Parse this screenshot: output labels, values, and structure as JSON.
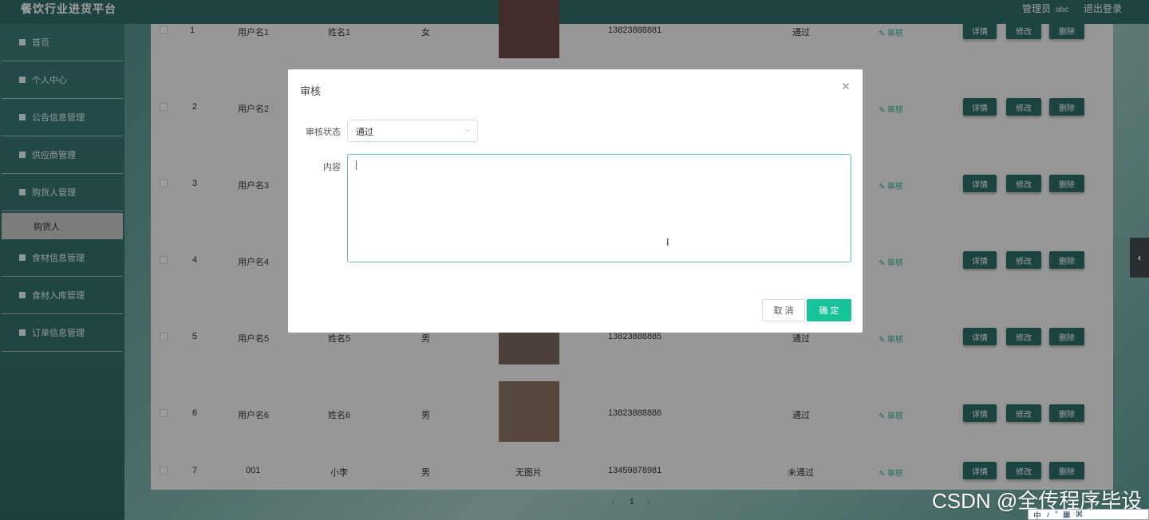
{
  "header": {
    "title": "餐饮行业进货平台",
    "user_label": "管理员",
    "user_name": "abc",
    "logout": "退出登录"
  },
  "sidebar": {
    "items": [
      {
        "label": "首页",
        "icon": "home-icon"
      },
      {
        "label": "个人中心",
        "icon": "user-icon"
      },
      {
        "label": "公告信息管理",
        "icon": "grid-icon"
      },
      {
        "label": "供应商管理",
        "icon": "grid-icon"
      },
      {
        "label": "购货人管理",
        "icon": "menu-icon"
      },
      {
        "label": "购货人",
        "icon": ""
      },
      {
        "label": "食材信息管理",
        "icon": "flag-icon"
      },
      {
        "label": "食材入库管理",
        "icon": "square-icon"
      },
      {
        "label": "订单信息管理",
        "icon": "list-icon"
      }
    ]
  },
  "table": {
    "rows": [
      {
        "idx": "1",
        "username": "用户名1",
        "name": "姓名1",
        "gender": "女",
        "photo": "",
        "phone": "13823888881",
        "status": "通过"
      },
      {
        "idx": "2",
        "username": "用户名2",
        "name": "",
        "gender": "",
        "photo": "",
        "phone": "",
        "status": ""
      },
      {
        "idx": "3",
        "username": "用户名3",
        "name": "",
        "gender": "",
        "photo": "",
        "phone": "",
        "status": ""
      },
      {
        "idx": "4",
        "username": "用户名4",
        "name": "",
        "gender": "",
        "photo": "",
        "phone": "",
        "status": ""
      },
      {
        "idx": "5",
        "username": "用户名5",
        "name": "姓名5",
        "gender": "男",
        "photo": "",
        "phone": "13823888885",
        "status": "通过"
      },
      {
        "idx": "6",
        "username": "用户名6",
        "name": "姓名6",
        "gender": "男",
        "photo": "",
        "phone": "13823888886",
        "status": "通过"
      },
      {
        "idx": "7",
        "username": "001",
        "name": "小李",
        "gender": "男",
        "photo": "无图片",
        "phone": "13459878981",
        "status": "未通过"
      }
    ],
    "audit_label": "审核",
    "detail_label": "详情",
    "edit_label": "修改",
    "delete_label": "删除"
  },
  "pagination": {
    "prev": "‹",
    "current": "1",
    "next": "›"
  },
  "modal": {
    "title": "审核",
    "status_label": "审核状态",
    "status_value": "通过",
    "content_label": "内容",
    "cancel": "取 消",
    "confirm": "确 定"
  },
  "watermark": "CSDN @全传程序毕设",
  "tray": [
    "中",
    "♪",
    "°",
    "▦",
    "⌘"
  ]
}
